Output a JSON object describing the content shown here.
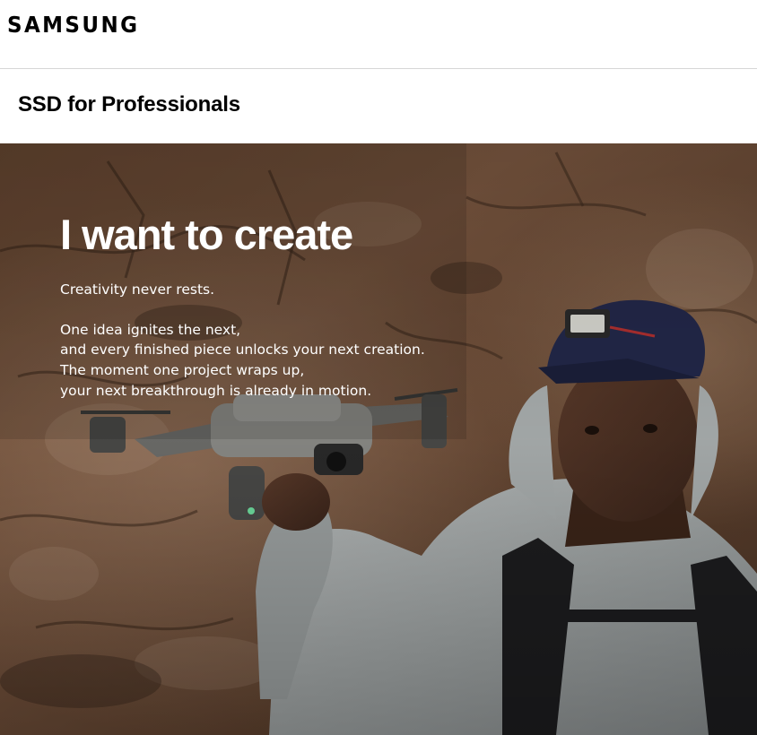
{
  "header": {
    "logo_text": "SAMSUNG"
  },
  "subnav": {
    "title": "SSD for Professionals"
  },
  "hero": {
    "heading": "I want to create",
    "lead": "Creativity never rests.",
    "body_lines": [
      "One idea ignites the next,",
      "and every finished piece unlocks your next creation.",
      "The moment one project wraps up,",
      "your next breakthrough is already in motion."
    ]
  },
  "colors": {
    "text_primary": "#000000",
    "hero_text": "#ffffff",
    "divider": "#d6d6d6",
    "rock_brown": "#6b4a33"
  }
}
